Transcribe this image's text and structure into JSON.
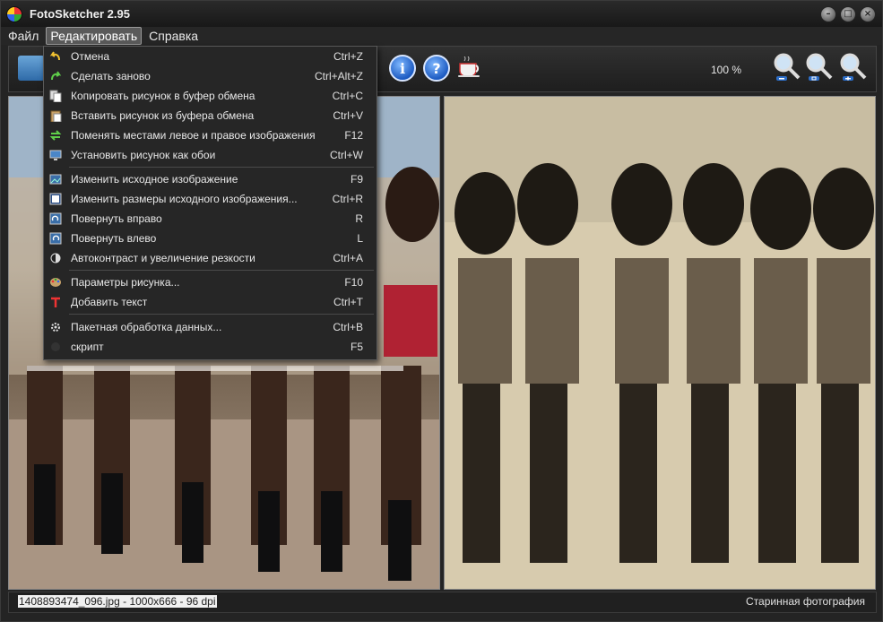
{
  "window": {
    "title": "FotoSketcher 2.95"
  },
  "menubar": {
    "items": [
      "Файл",
      "Редактировать",
      "Справка"
    ],
    "active_index": 1
  },
  "toolbar": {
    "zoom": "100 %"
  },
  "edit_menu": {
    "items": [
      {
        "label": "Отмена",
        "shortcut": "Ctrl+Z",
        "icon": "undo-icon"
      },
      {
        "label": "Сделать заново",
        "shortcut": "Ctrl+Alt+Z",
        "icon": "redo-icon"
      },
      {
        "label": "Копировать рисунок в буфер обмена",
        "shortcut": "Ctrl+C",
        "icon": "copy-icon"
      },
      {
        "label": "Вставить рисунок из буфера обмена",
        "shortcut": "Ctrl+V",
        "icon": "paste-icon"
      },
      {
        "label": "Поменять местами левое и правое изображения",
        "shortcut": "F12",
        "icon": "swap-icon"
      },
      {
        "label": "Установить рисунок как обои",
        "shortcut": "Ctrl+W",
        "icon": "wallpaper-icon"
      },
      {
        "label": "Изменить исходное изображение",
        "shortcut": "F9",
        "icon": "edit-image-icon"
      },
      {
        "label": "Изменить размеры исходного изображения...",
        "shortcut": "Ctrl+R",
        "icon": "resize-icon"
      },
      {
        "label": "Повернуть вправо",
        "shortcut": "R",
        "icon": "rotate-right-icon"
      },
      {
        "label": "Повернуть влево",
        "shortcut": "L",
        "icon": "rotate-left-icon"
      },
      {
        "label": "Автоконтраст и увеличение резкости",
        "shortcut": "Ctrl+A",
        "icon": "contrast-icon"
      },
      {
        "label": "Параметры рисунка...",
        "shortcut": "F10",
        "icon": "palette-icon"
      },
      {
        "label": "Добавить текст",
        "shortcut": "Ctrl+T",
        "icon": "text-icon"
      },
      {
        "label": "Пакетная обработка данных...",
        "shortcut": "Ctrl+B",
        "icon": "batch-icon"
      },
      {
        "label": "скрипт",
        "shortcut": "F5",
        "icon": "script-icon"
      }
    ]
  },
  "status": {
    "file_info": "1408893474_096.jpg - 1000x666 - 96 dpi",
    "effect": "Старинная фотография"
  }
}
